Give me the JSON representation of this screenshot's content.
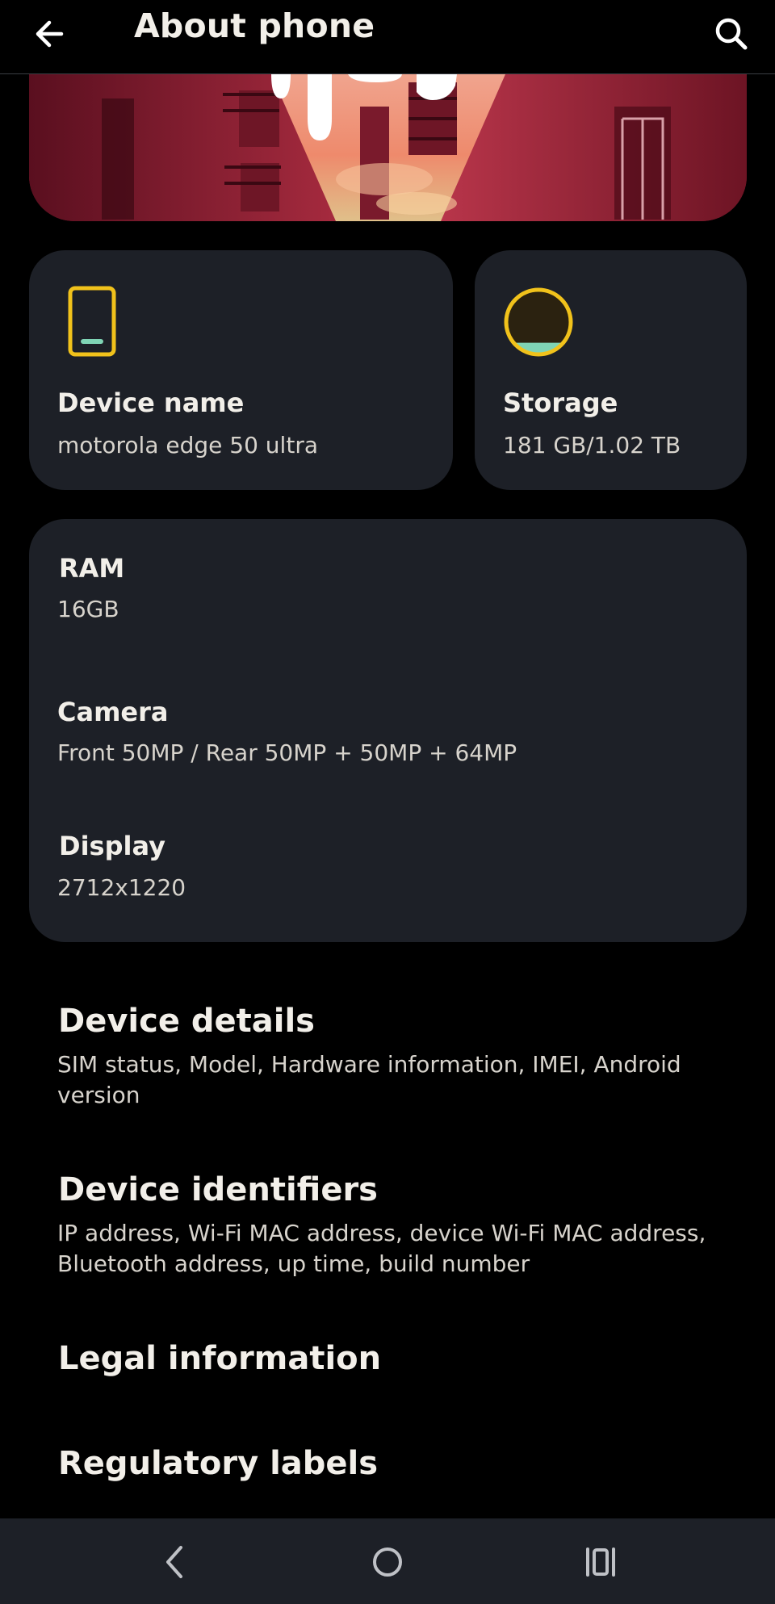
{
  "app_bar": {
    "title": "About phone",
    "back_icon": "arrow-left-icon",
    "search_icon": "search-icon"
  },
  "hero": {
    "image": "moto wallpaper banner"
  },
  "device_card": {
    "title": "Device name",
    "value": "motorola edge 50 ultra",
    "icon": "phone-icon",
    "icon_color": "#f1c21b"
  },
  "storage_card": {
    "title": "Storage",
    "value": "181 GB/1.02 TB",
    "icon": "storage-circle-icon",
    "icon_color": "#f1c21b",
    "used_fraction": 0.18
  },
  "specs": [
    {
      "label": "RAM",
      "value": "16GB"
    },
    {
      "label": "Camera",
      "value": "Front 50MP / Rear 50MP + 50MP + 64MP"
    },
    {
      "label": "Display",
      "value": "2712x1220"
    }
  ],
  "list": [
    {
      "title": "Device details",
      "subtitle": "SIM status, Model, Hardware information, IMEI, Android version"
    },
    {
      "title": "Device identifiers",
      "subtitle": "IP address, Wi-Fi MAC address, device Wi-Fi MAC address, Bluetooth address, up time, build number"
    },
    {
      "title": "Legal information",
      "subtitle": ""
    },
    {
      "title": "Regulatory labels",
      "subtitle": ""
    }
  ],
  "nav_bar": {
    "back": "nav-back-icon",
    "home": "nav-home-icon",
    "recents": "nav-recents-icon"
  },
  "colors": {
    "background": "#000000",
    "card": "#1d2027",
    "accent": "#f1c21b",
    "text_primary": "#f2efe9",
    "text_secondary": "#d7d3cc"
  }
}
